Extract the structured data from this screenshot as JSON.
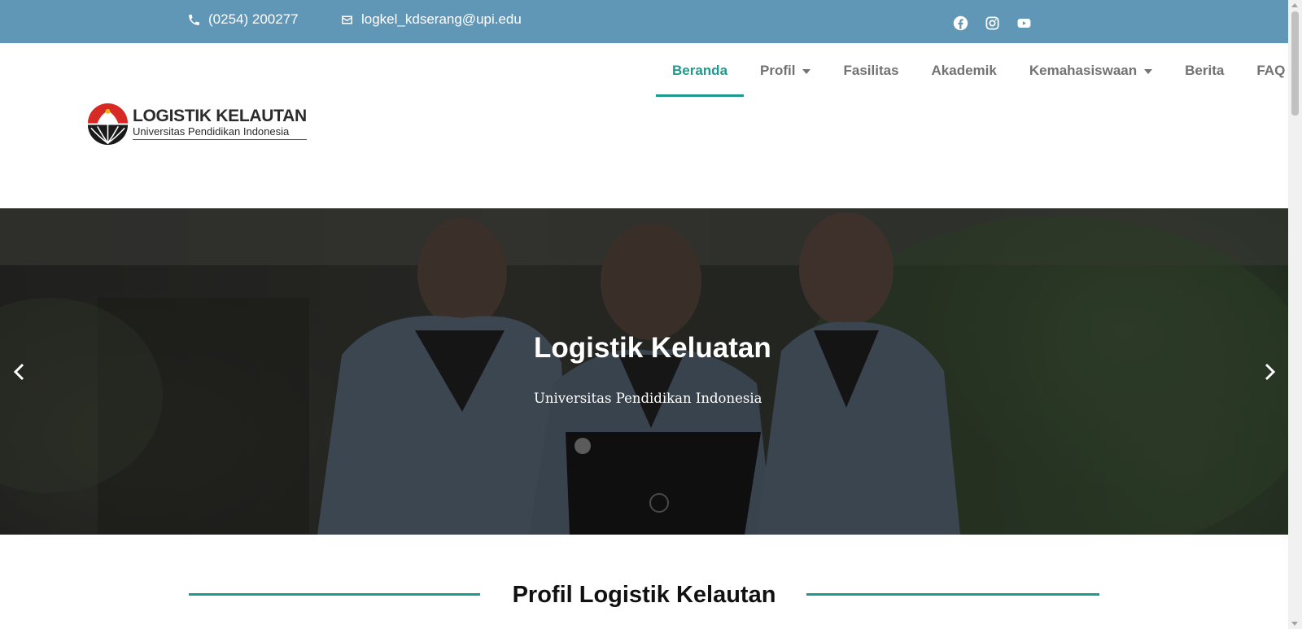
{
  "topbar": {
    "phone": "(0254) 200277",
    "email": "logkel_kdserang@upi.edu",
    "phone_icon": "phone-icon",
    "email_icon": "envelope-icon",
    "social": [
      "facebook-icon",
      "instagram-icon",
      "youtube-icon"
    ],
    "background": "#6097b7"
  },
  "nav": {
    "items": [
      {
        "label": "Beranda",
        "active": true
      },
      {
        "label": "Profil",
        "dropdown": true
      },
      {
        "label": "Fasilitas"
      },
      {
        "label": "Akademik"
      },
      {
        "label": "Kemahasiswaan",
        "dropdown": true
      },
      {
        "label": "Berita"
      },
      {
        "label": "FAQ"
      }
    ],
    "accent": "#1d9a8f"
  },
  "logo": {
    "title": "LOGISTIK KELAUTAN",
    "subtitle": "Universitas Pendidikan Indonesia"
  },
  "hero": {
    "title": "Logistik Keluatan",
    "subtitle": "Universitas Pendidikan Indonesia",
    "prev_icon": "chevron-left-icon",
    "next_icon": "chevron-right-icon"
  },
  "section": {
    "title": "Profil Logistik Kelautan"
  }
}
